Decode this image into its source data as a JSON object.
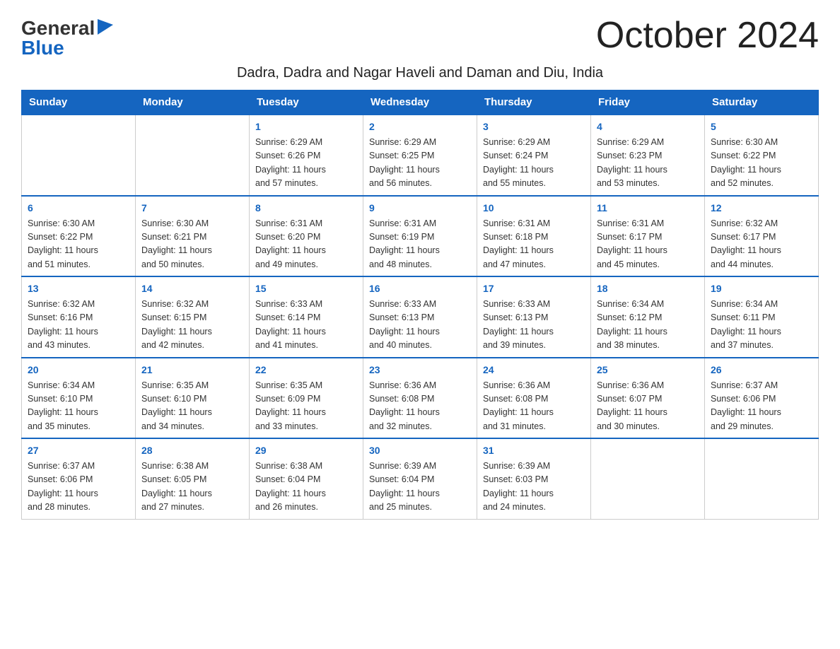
{
  "logo": {
    "general": "General",
    "blue": "Blue",
    "triangle": "▶"
  },
  "title": "October 2024",
  "subtitle": "Dadra, Dadra and Nagar Haveli and Daman and Diu, India",
  "weekdays": [
    "Sunday",
    "Monday",
    "Tuesday",
    "Wednesday",
    "Thursday",
    "Friday",
    "Saturday"
  ],
  "weeks": [
    [
      {
        "day": "",
        "info": ""
      },
      {
        "day": "",
        "info": ""
      },
      {
        "day": "1",
        "info": "Sunrise: 6:29 AM\nSunset: 6:26 PM\nDaylight: 11 hours\nand 57 minutes."
      },
      {
        "day": "2",
        "info": "Sunrise: 6:29 AM\nSunset: 6:25 PM\nDaylight: 11 hours\nand 56 minutes."
      },
      {
        "day": "3",
        "info": "Sunrise: 6:29 AM\nSunset: 6:24 PM\nDaylight: 11 hours\nand 55 minutes."
      },
      {
        "day": "4",
        "info": "Sunrise: 6:29 AM\nSunset: 6:23 PM\nDaylight: 11 hours\nand 53 minutes."
      },
      {
        "day": "5",
        "info": "Sunrise: 6:30 AM\nSunset: 6:22 PM\nDaylight: 11 hours\nand 52 minutes."
      }
    ],
    [
      {
        "day": "6",
        "info": "Sunrise: 6:30 AM\nSunset: 6:22 PM\nDaylight: 11 hours\nand 51 minutes."
      },
      {
        "day": "7",
        "info": "Sunrise: 6:30 AM\nSunset: 6:21 PM\nDaylight: 11 hours\nand 50 minutes."
      },
      {
        "day": "8",
        "info": "Sunrise: 6:31 AM\nSunset: 6:20 PM\nDaylight: 11 hours\nand 49 minutes."
      },
      {
        "day": "9",
        "info": "Sunrise: 6:31 AM\nSunset: 6:19 PM\nDaylight: 11 hours\nand 48 minutes."
      },
      {
        "day": "10",
        "info": "Sunrise: 6:31 AM\nSunset: 6:18 PM\nDaylight: 11 hours\nand 47 minutes."
      },
      {
        "day": "11",
        "info": "Sunrise: 6:31 AM\nSunset: 6:17 PM\nDaylight: 11 hours\nand 45 minutes."
      },
      {
        "day": "12",
        "info": "Sunrise: 6:32 AM\nSunset: 6:17 PM\nDaylight: 11 hours\nand 44 minutes."
      }
    ],
    [
      {
        "day": "13",
        "info": "Sunrise: 6:32 AM\nSunset: 6:16 PM\nDaylight: 11 hours\nand 43 minutes."
      },
      {
        "day": "14",
        "info": "Sunrise: 6:32 AM\nSunset: 6:15 PM\nDaylight: 11 hours\nand 42 minutes."
      },
      {
        "day": "15",
        "info": "Sunrise: 6:33 AM\nSunset: 6:14 PM\nDaylight: 11 hours\nand 41 minutes."
      },
      {
        "day": "16",
        "info": "Sunrise: 6:33 AM\nSunset: 6:13 PM\nDaylight: 11 hours\nand 40 minutes."
      },
      {
        "day": "17",
        "info": "Sunrise: 6:33 AM\nSunset: 6:13 PM\nDaylight: 11 hours\nand 39 minutes."
      },
      {
        "day": "18",
        "info": "Sunrise: 6:34 AM\nSunset: 6:12 PM\nDaylight: 11 hours\nand 38 minutes."
      },
      {
        "day": "19",
        "info": "Sunrise: 6:34 AM\nSunset: 6:11 PM\nDaylight: 11 hours\nand 37 minutes."
      }
    ],
    [
      {
        "day": "20",
        "info": "Sunrise: 6:34 AM\nSunset: 6:10 PM\nDaylight: 11 hours\nand 35 minutes."
      },
      {
        "day": "21",
        "info": "Sunrise: 6:35 AM\nSunset: 6:10 PM\nDaylight: 11 hours\nand 34 minutes."
      },
      {
        "day": "22",
        "info": "Sunrise: 6:35 AM\nSunset: 6:09 PM\nDaylight: 11 hours\nand 33 minutes."
      },
      {
        "day": "23",
        "info": "Sunrise: 6:36 AM\nSunset: 6:08 PM\nDaylight: 11 hours\nand 32 minutes."
      },
      {
        "day": "24",
        "info": "Sunrise: 6:36 AM\nSunset: 6:08 PM\nDaylight: 11 hours\nand 31 minutes."
      },
      {
        "day": "25",
        "info": "Sunrise: 6:36 AM\nSunset: 6:07 PM\nDaylight: 11 hours\nand 30 minutes."
      },
      {
        "day": "26",
        "info": "Sunrise: 6:37 AM\nSunset: 6:06 PM\nDaylight: 11 hours\nand 29 minutes."
      }
    ],
    [
      {
        "day": "27",
        "info": "Sunrise: 6:37 AM\nSunset: 6:06 PM\nDaylight: 11 hours\nand 28 minutes."
      },
      {
        "day": "28",
        "info": "Sunrise: 6:38 AM\nSunset: 6:05 PM\nDaylight: 11 hours\nand 27 minutes."
      },
      {
        "day": "29",
        "info": "Sunrise: 6:38 AM\nSunset: 6:04 PM\nDaylight: 11 hours\nand 26 minutes."
      },
      {
        "day": "30",
        "info": "Sunrise: 6:39 AM\nSunset: 6:04 PM\nDaylight: 11 hours\nand 25 minutes."
      },
      {
        "day": "31",
        "info": "Sunrise: 6:39 AM\nSunset: 6:03 PM\nDaylight: 11 hours\nand 24 minutes."
      },
      {
        "day": "",
        "info": ""
      },
      {
        "day": "",
        "info": ""
      }
    ]
  ]
}
